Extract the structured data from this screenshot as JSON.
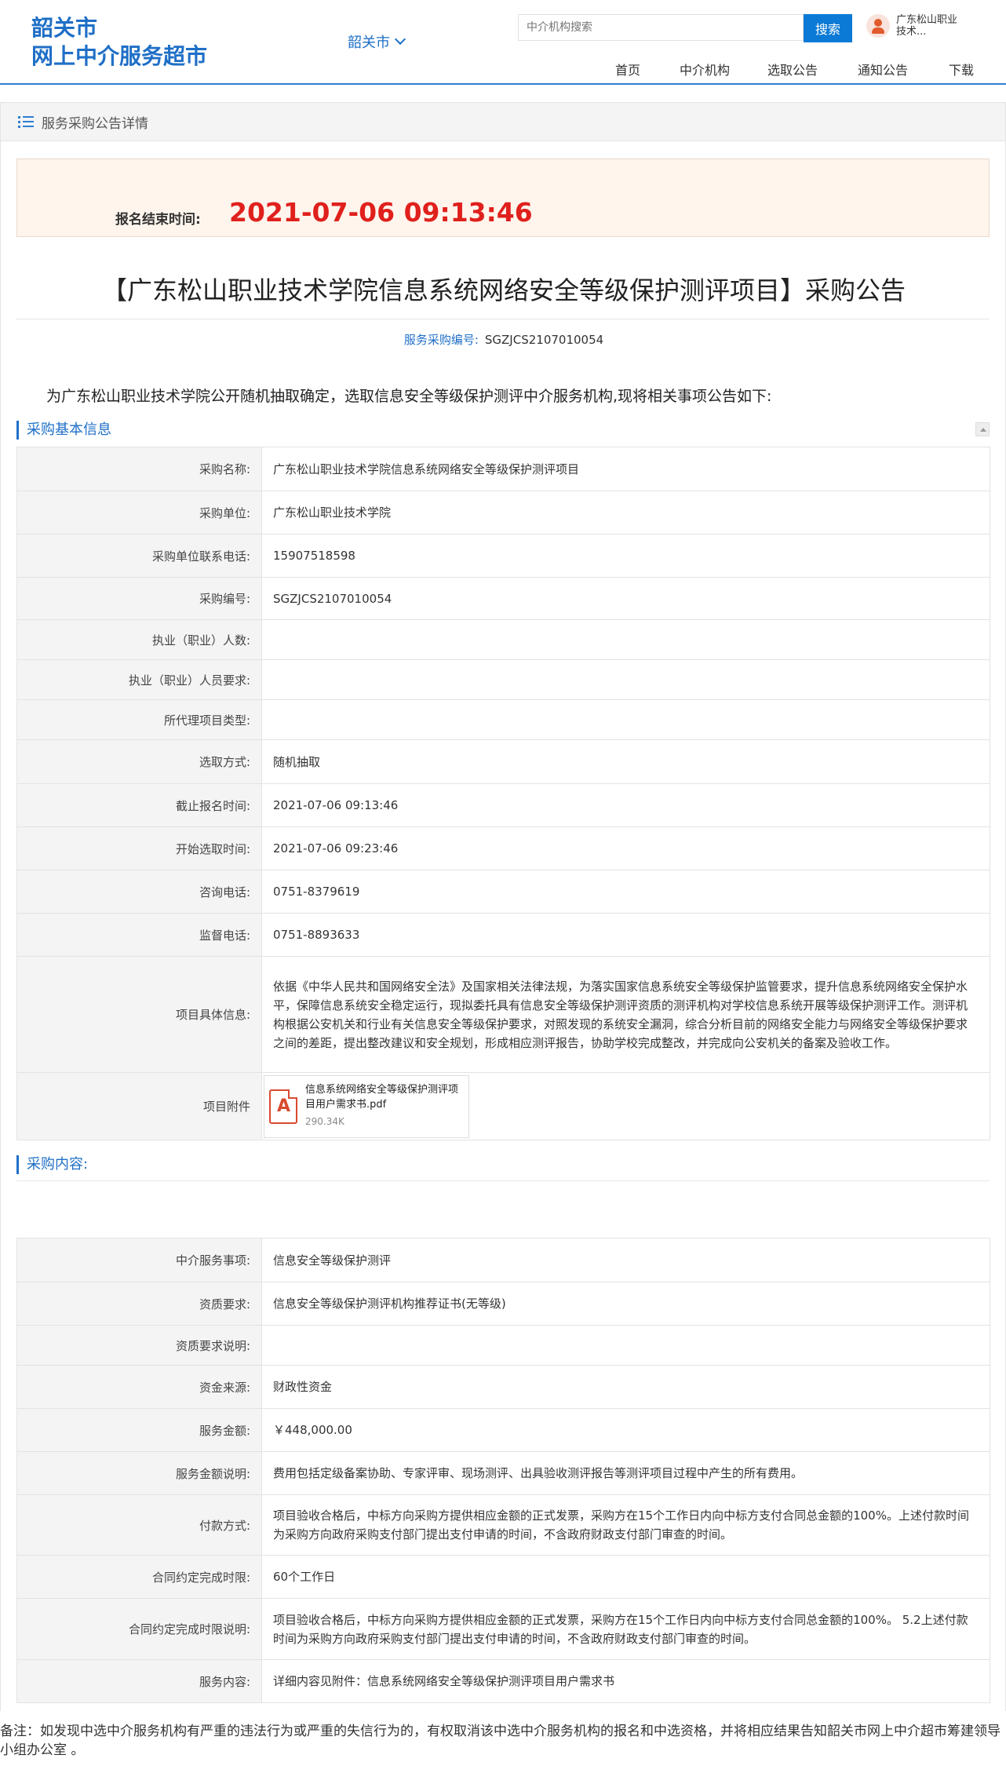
{
  "header": {
    "logo_line1": "韶关市",
    "logo_line2": "网上中介服务超市",
    "city": "韶关市",
    "search_placeholder": "中介机构搜索",
    "search_button": "搜索",
    "user_name": "广东松山职业技术...",
    "nav": [
      "首页",
      "中介机构",
      "选取公告",
      "通知公告",
      "下载"
    ]
  },
  "breadcrumb": "服务采购公告详情",
  "deadline": {
    "label": "报名结束时间:",
    "value": "2021-07-06 09:13:46"
  },
  "title": "【广东松山职业技术学院信息系统网络安全等级保护测评项目】采购公告",
  "code": {
    "label": "服务采购编号:",
    "value": "SGZJCS2107010054"
  },
  "intro": "为广东松山职业技术学院公开随机抽取确定，选取信息安全等级保护测评中介服务机构,现将相关事项公告如下:",
  "basic": {
    "title": "采购基本信息",
    "rows": [
      {
        "label": "采购名称:",
        "value": "广东松山职业技术学院信息系统网络安全等级保护测评项目"
      },
      {
        "label": "采购单位:",
        "value": "广东松山职业技术学院"
      },
      {
        "label": "采购单位联系电话:",
        "value": "15907518598"
      },
      {
        "label": "采购编号:",
        "value": "SGZJCS2107010054"
      },
      {
        "label": "执业（职业）人数:",
        "value": ""
      },
      {
        "label": "执业（职业）人员要求:",
        "value": ""
      },
      {
        "label": "所代理项目类型:",
        "value": ""
      },
      {
        "label": "选取方式:",
        "value": "随机抽取"
      },
      {
        "label": "截止报名时间:",
        "value": "2021-07-06 09:13:46"
      },
      {
        "label": "开始选取时间:",
        "value": "2021-07-06 09:23:46"
      },
      {
        "label": "咨询电话:",
        "value": "0751-8379619"
      },
      {
        "label": "监督电话:",
        "value": "0751-8893633"
      },
      {
        "label": "项目具体信息:",
        "value": "依据《中华人民共和国网络安全法》及国家相关法律法规，为落实国家信息系统安全等级保护监管要求，提升信息系统网络安全保护水平，保障信息系统安全稳定运行，现拟委托具有信息安全等级保护测评资质的测评机构对学校信息系统开展等级保护测评工作。测评机构根据公安机关和行业有关信息安全等级保护要求，对照发现的系统安全漏洞，综合分析目前的网络安全能力与网络安全等级保护要求之间的差距，提出整改建议和安全规划，形成相应测评报告，协助学校完成整改，并完成向公安机关的备案及验收工作。"
      }
    ],
    "attachment": {
      "label": "项目附件",
      "name": "信息系统网络安全等级保护测评项目用户需求书.pdf",
      "size": "290.34K",
      "icon": "pdf-icon"
    }
  },
  "content": {
    "title": "采购内容:",
    "rows": [
      {
        "label": "中介服务事项:",
        "value": "信息安全等级保护测评"
      },
      {
        "label": "资质要求:",
        "value": "信息安全等级保护测评机构推荐证书(无等级)"
      },
      {
        "label": "资质要求说明:",
        "value": ""
      },
      {
        "label": "资金来源:",
        "value": "财政性资金"
      },
      {
        "label": "服务金额:",
        "value": "￥448,000.00"
      },
      {
        "label": "服务金额说明:",
        "value": "费用包括定级备案协助、专家评审、现场测评、出具验收测评报告等测评项目过程中产生的所有费用。"
      },
      {
        "label": "付款方式:",
        "value": "项目验收合格后，中标方向采购方提供相应金额的正式发票，采购方在15个工作日内向中标方支付合同总金额的100%。上述付款时间为采购方向政府采购支付部门提出支付申请的时间，不含政府财政支付部门审查的时间。"
      },
      {
        "label": "合同约定完成时限:",
        "value": "60个工作日"
      },
      {
        "label": "合同约定完成时限说明:",
        "value": "项目验收合格后，中标方向采购方提供相应金额的正式发票，采购方在15个工作日内向中标方支付合同总金额的100%。 5.2上述付款时间为采购方向政府采购支付部门提出支付申请的时间，不含政府财政支付部门审查的时间。"
      },
      {
        "label": "服务内容:",
        "value": "详细内容见附件：信息系统网络安全等级保护测评项目用户需求书"
      }
    ]
  },
  "note": "备注：如发现中选中介服务机构有严重的违法行为或严重的失信行为的，有权取消该中选中介服务机构的报名和中选资格，并将相应结果告知韶关市网上中介超市筹建领导小组办公室 。"
}
